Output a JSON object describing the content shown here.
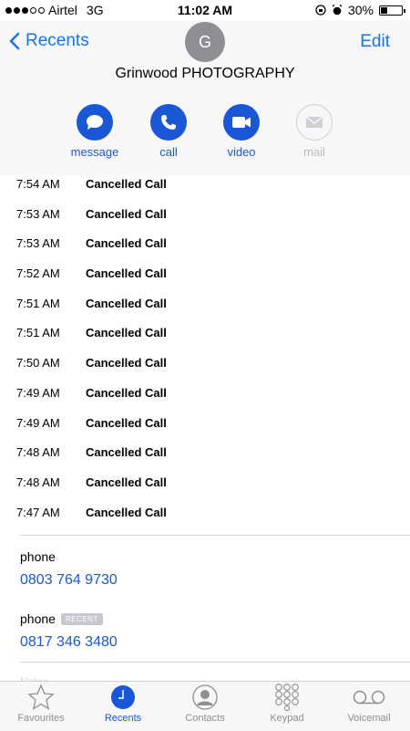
{
  "status_bar": {
    "carrier": "Airtel",
    "network": "3G",
    "time": "11:02 AM",
    "battery": "30%",
    "battery_level": 0.3
  },
  "header": {
    "back_label": "Recents",
    "edit_label": "Edit",
    "avatar_initial": "G",
    "contact_name": "Grinwood PHOTOGRAPHY",
    "actions": [
      {
        "label": "message",
        "icon": "message-icon",
        "enabled": true
      },
      {
        "label": "call",
        "icon": "phone-icon",
        "enabled": true
      },
      {
        "label": "video",
        "icon": "video-icon",
        "enabled": true
      },
      {
        "label": "mail",
        "icon": "mail-icon",
        "enabled": false
      }
    ]
  },
  "calls": [
    {
      "time": "7:54 AM",
      "type": "Cancelled Call"
    },
    {
      "time": "7:53 AM",
      "type": "Cancelled Call"
    },
    {
      "time": "7:53 AM",
      "type": "Cancelled Call"
    },
    {
      "time": "7:52 AM",
      "type": "Cancelled Call"
    },
    {
      "time": "7:51 AM",
      "type": "Cancelled Call"
    },
    {
      "time": "7:51 AM",
      "type": "Cancelled Call"
    },
    {
      "time": "7:50 AM",
      "type": "Cancelled Call"
    },
    {
      "time": "7:49 AM",
      "type": "Cancelled Call"
    },
    {
      "time": "7:49 AM",
      "type": "Cancelled Call"
    },
    {
      "time": "7:48 AM",
      "type": "Cancelled Call"
    },
    {
      "time": "7:48 AM",
      "type": "Cancelled Call"
    },
    {
      "time": "7:47 AM",
      "type": "Cancelled Call"
    }
  ],
  "phones": [
    {
      "label": "phone",
      "badge": "",
      "number": "0803 764 9730"
    },
    {
      "label": "phone",
      "badge": "RECENT",
      "number": "0817 346 3480"
    }
  ],
  "notes_label": "Notes",
  "tabbar": [
    {
      "label": "Favourites",
      "icon": "star-icon",
      "active": false
    },
    {
      "label": "Recents",
      "icon": "clock-icon",
      "active": true
    },
    {
      "label": "Contacts",
      "icon": "contact-icon",
      "active": false
    },
    {
      "label": "Keypad",
      "icon": "keypad-icon",
      "active": false
    },
    {
      "label": "Voicemail",
      "icon": "voicemail-icon",
      "active": false
    }
  ],
  "colors": {
    "accent": "#1a57d6",
    "link": "#1a73e8",
    "inactive": "#8e8e93",
    "header_bg": "#f7f7f8"
  }
}
